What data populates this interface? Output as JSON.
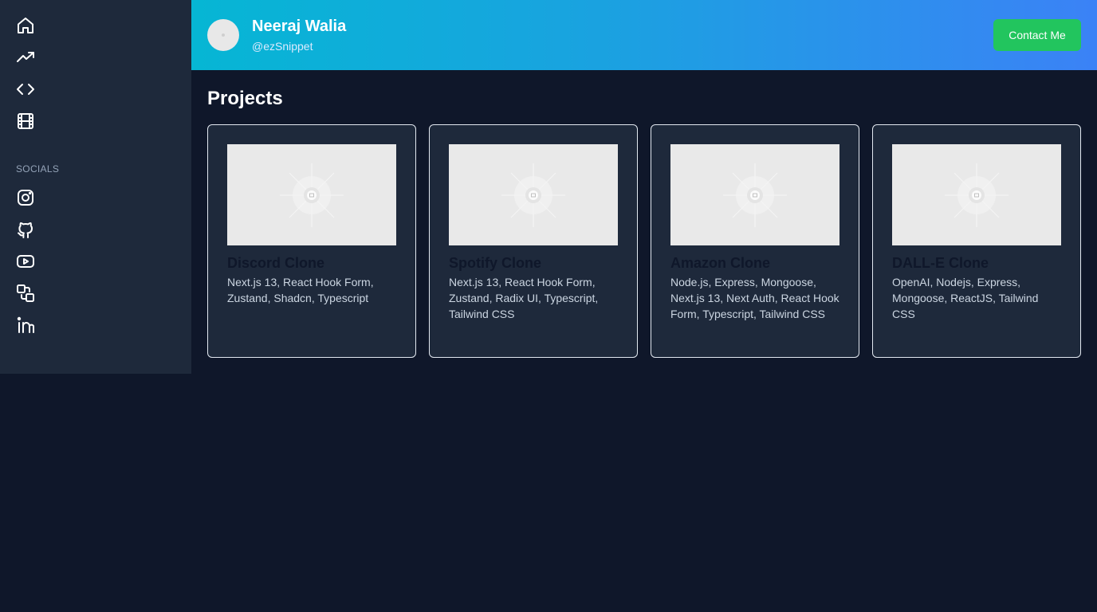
{
  "sidebar": {
    "nav_icons": [
      "home-icon",
      "trending-icon",
      "code-icon",
      "film-icon"
    ],
    "socials_label": "SOCIALS",
    "social_icons": [
      "instagram-icon",
      "github-icon",
      "youtube-icon",
      "linkedin-icon"
    ]
  },
  "header": {
    "name": "Neeraj Walia",
    "handle": "@ezSnippet",
    "contact_label": "Contact Me"
  },
  "main": {
    "title": "Projects",
    "projects": [
      {
        "title": "Discord Clone",
        "tech": "Next.js 13, React Hook Form, Zustand, Shadcn, Typescript"
      },
      {
        "title": "Spotify Clone",
        "tech": "Next.js 13, React Hook Form, Zustand, Radix UI, Typescript, Tailwind CSS"
      },
      {
        "title": "Amazon Clone",
        "tech": "Node.js, Express, Mongoose, Next.js 13, Next Auth, React Hook Form, Typescript, Tailwind CSS"
      },
      {
        "title": "DALL-E Clone",
        "tech": "OpenAI, Nodejs, Express, Mongoose, ReactJS, Tailwind CSS"
      }
    ]
  },
  "colors": {
    "page_bg": "#0f172a",
    "sidebar_bg": "#1e293b",
    "header_gradient_start": "#06b6d4",
    "header_gradient_end": "#3b82f6",
    "contact_button": "#22c55e"
  }
}
